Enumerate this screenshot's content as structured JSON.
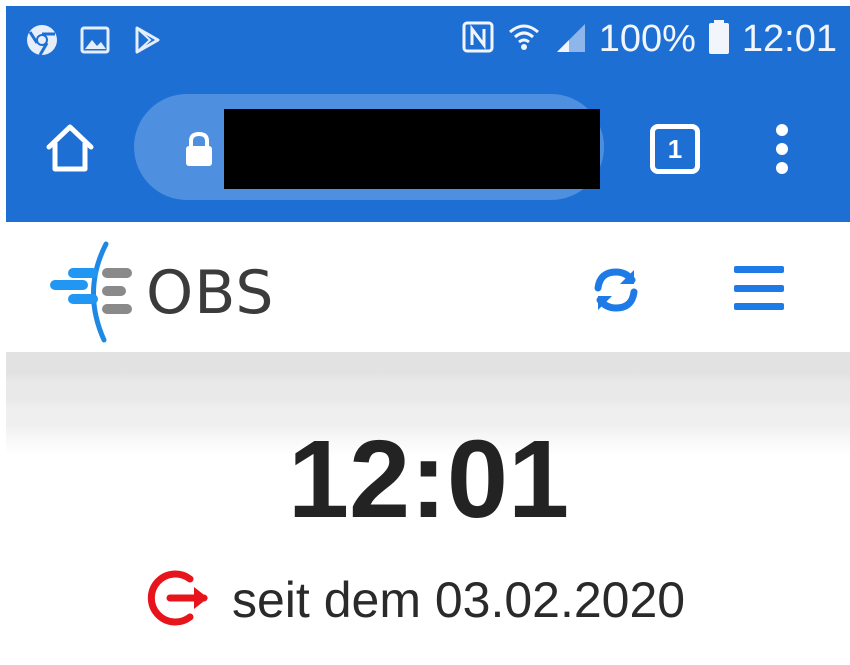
{
  "status_bar": {
    "icons_left": [
      "chrome-icon",
      "image-icon",
      "play-store-icon"
    ],
    "icons_right": [
      "nfc-icon",
      "wifi-icon",
      "signal-icon"
    ],
    "battery": "100%",
    "clock": "12:01"
  },
  "browser": {
    "tab_count": "1",
    "url_redacted": true
  },
  "app": {
    "logo_text": "OBS",
    "accent_color": "#1e7ae6"
  },
  "main": {
    "time": "12:01",
    "since_text": "seit dem 03.02.2020",
    "status_icon_color": "#e8141b"
  }
}
